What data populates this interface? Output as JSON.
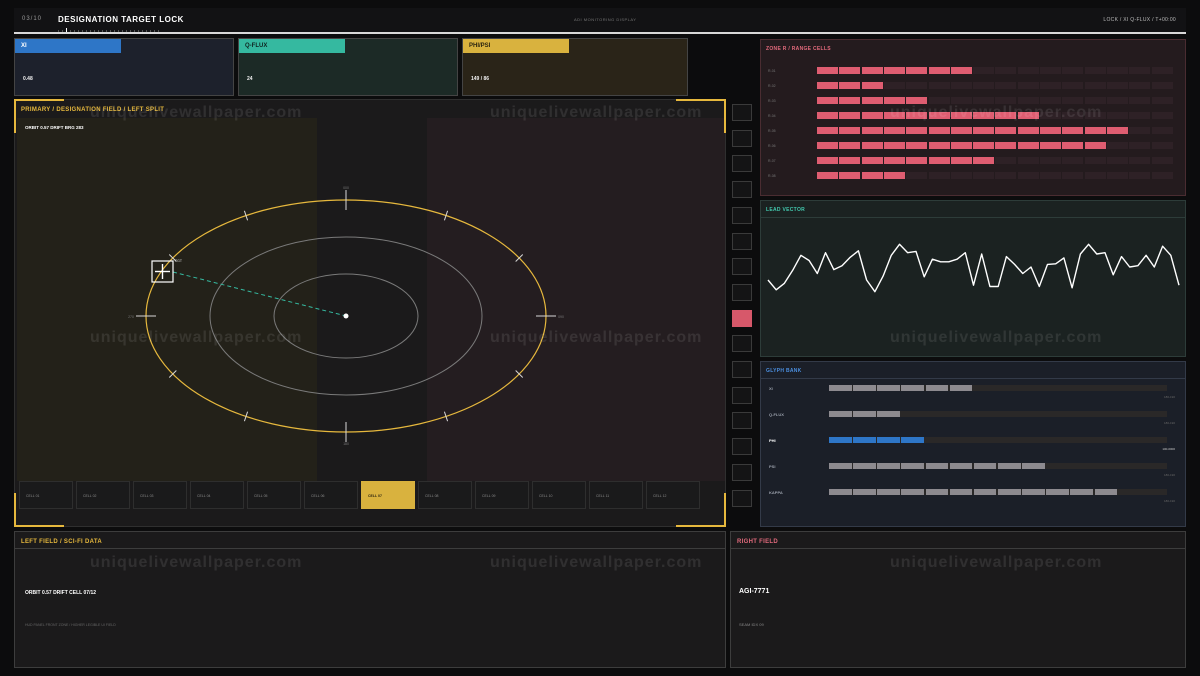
{
  "header": {
    "index": "03/10",
    "title": "DESIGNATION TARGET LOCK",
    "mode": "ADI MONITORING DISPLAY",
    "status": "LOCK / XI Q-FLUX / T+00:00"
  },
  "metrics": [
    {
      "label": "XI",
      "value": "0.48",
      "color": "#2e76c7"
    },
    {
      "label": "Q-FLUX",
      "value": "24",
      "color": "#35b9a0"
    },
    {
      "label": "PHI/PSI",
      "value": "149 / 86",
      "color": "#d9b23e"
    }
  ],
  "field": {
    "title": "PRIMARY / DESIGNATION FIELD / LEFT SPLIT",
    "readout": "ORBIT 0.57   DRIFT   BRG 283",
    "target_label": "TGT",
    "compass": {
      "top": "000",
      "bottom": "180",
      "left": "270",
      "right": "090"
    },
    "cells": [
      "CELL 01",
      "CELL 02",
      "CELL 03",
      "CELL 04",
      "CELL 05",
      "CELL 06",
      "CELL 07",
      "CELL 08",
      "CELL 09",
      "CELL 10",
      "CELL 11",
      "CELL 12"
    ],
    "active_cell": 6
  },
  "side_stack": {
    "count": 16,
    "active_index": 8
  },
  "zone": {
    "title": "ZONE R / RANGE CELLS",
    "color": "#df5d71",
    "rows": [
      {
        "label": "R-01",
        "fill": 7
      },
      {
        "label": "R-02",
        "fill": 3
      },
      {
        "label": "R-03",
        "fill": 5
      },
      {
        "label": "R-04",
        "fill": 10
      },
      {
        "label": "R-05",
        "fill": 14
      },
      {
        "label": "R-06",
        "fill": 13
      },
      {
        "label": "R-07",
        "fill": 8
      },
      {
        "label": "R-08",
        "fill": 4
      }
    ],
    "total_segments": 16
  },
  "lead": {
    "title": "LEAD VECTOR",
    "color": "#35b9a0",
    "values": [
      0.4,
      0.25,
      0.35,
      0.55,
      0.78,
      0.7,
      0.5,
      0.82,
      0.56,
      0.62,
      0.75,
      0.85,
      0.4,
      0.22,
      0.46,
      0.78,
      0.95,
      0.82,
      0.84,
      0.45,
      0.72,
      0.68,
      0.68,
      0.72,
      0.82,
      0.32,
      0.8,
      0.3,
      0.3,
      0.76,
      0.64,
      0.5,
      0.6,
      0.3,
      0.64,
      0.65,
      0.74,
      0.28,
      0.8,
      0.95,
      0.8,
      0.82,
      0.48,
      0.76,
      0.6,
      0.62,
      0.78,
      0.6,
      0.92,
      0.78,
      0.32
    ]
  },
  "glyph": {
    "title": "GLYPH BANK",
    "color": "#2e76c7",
    "rows": [
      {
        "label": "XI",
        "fill": 0.42,
        "highlight": false,
        "foot": "180-190"
      },
      {
        "label": "Q-FLUX",
        "fill": 0.21,
        "highlight": false,
        "foot": "180-190"
      },
      {
        "label": "PHI",
        "fill": 0.28,
        "highlight": true,
        "foot": "100-0000"
      },
      {
        "label": "PSI",
        "fill": 0.64,
        "highlight": false,
        "foot": "180-190"
      },
      {
        "label": "KAPPA",
        "fill": 0.86,
        "highlight": false,
        "foot": "180-190"
      }
    ]
  },
  "left_field": {
    "title": "LEFT FIELD / SCI-FI DATA",
    "readout": "ORBIT 0.57   DRIFT   CELL 07/12",
    "foot": "HUD PANEL FRONT ZONE / HIGHER LEGIBLE UI FIELD"
  },
  "right_field": {
    "title": "RIGHT FIELD",
    "id": "AGI-7771",
    "foot": "SEAM IDX 09"
  },
  "watermark": "uniquelivewallpaper.com"
}
